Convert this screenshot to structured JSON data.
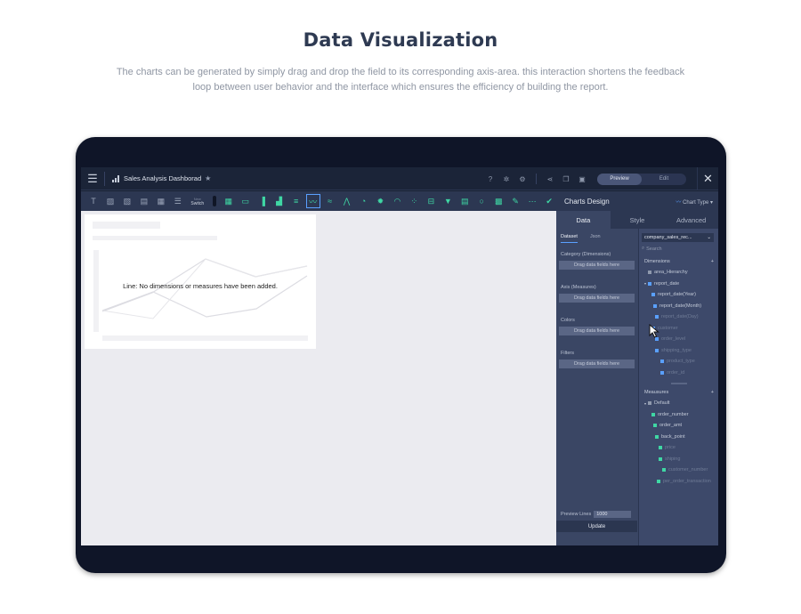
{
  "hero": {
    "title": "Data Visualization",
    "subtitle": "The charts can be generated by simply drag and drop the field to its corresponding axis-area. this interaction shortens the feedback loop between user behavior and the interface which ensures the efficiency of building the report."
  },
  "app": {
    "title": "Sales Analysis Dashborad",
    "preview_label": "Preview",
    "edit_label": "Edit"
  },
  "toolbar": {
    "switch_top": "New",
    "switch_label": "Switch"
  },
  "canvas": {
    "chart_message": "Line: No dimensions or measures have been added."
  },
  "panel": {
    "title": "Charts Design",
    "chart_type_label": "Chart Type",
    "tabs": [
      "Data",
      "Style",
      "Advanced"
    ],
    "sub_tabs": [
      "Dataset",
      "Json"
    ],
    "sections": [
      {
        "label": "Category (Dimensions)",
        "drop": "Drag data fields here"
      },
      {
        "label": "Axis (Measures)",
        "drop": "Drag data fields here"
      },
      {
        "label": "Colors",
        "drop": "Drag data fields here"
      },
      {
        "label": "Filters",
        "drop": "Drag data fields here"
      }
    ],
    "preview_lines_label": "Preview Lines",
    "preview_lines_value": "1000",
    "update_label": "Update",
    "dataset": "company_sales_rec...",
    "search_placeholder": "Search",
    "dimensions_label": "Dimensions",
    "dimensions": [
      "area_Hierarchy",
      "report_date",
      "report_date(Year)",
      "report_date(Month)",
      "report_date(Day)",
      "customer",
      "order_level",
      "shipping_type",
      "product_type",
      "order_id"
    ],
    "measures_label": "Meausures",
    "measures": [
      "Default",
      "order_number",
      "order_amt",
      "back_point",
      "price",
      "shiping",
      "customer_number",
      "per_order_transaction"
    ]
  },
  "colors": {
    "accent": "#3fd7a4",
    "selection": "#5aa0ff",
    "frame": "#0f1528"
  }
}
